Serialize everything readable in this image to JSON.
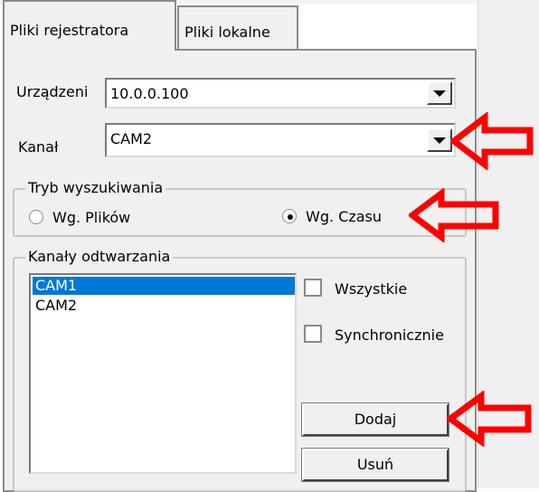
{
  "tabs": [
    {
      "label": "Pliki rejestratora",
      "active": true
    },
    {
      "label": "Pliki lokalne",
      "active": false
    }
  ],
  "device": {
    "label": "Urządzeni",
    "value": "10.0.0.100"
  },
  "channel": {
    "label": "Kanał",
    "value": "CAM2"
  },
  "search_mode": {
    "title": "Tryb wyszukiwania",
    "options": [
      {
        "label": "Wg. Plików",
        "selected": false
      },
      {
        "label": "Wg. Czasu",
        "selected": true
      }
    ]
  },
  "playback_channels": {
    "title": "Kanały odtwarzania",
    "items": [
      {
        "label": "CAM1",
        "selected": true
      },
      {
        "label": "CAM2",
        "selected": false
      }
    ],
    "checkboxes": [
      {
        "label": "Wszystkie",
        "checked": false
      },
      {
        "label": "Synchronicznie",
        "checked": false
      }
    ],
    "buttons": {
      "add": "Dodaj",
      "remove": "Usuń"
    }
  },
  "colors": {
    "selection": "#0078d7",
    "callout_arrow": "#ff0000",
    "panel": "#f0f0f0"
  }
}
